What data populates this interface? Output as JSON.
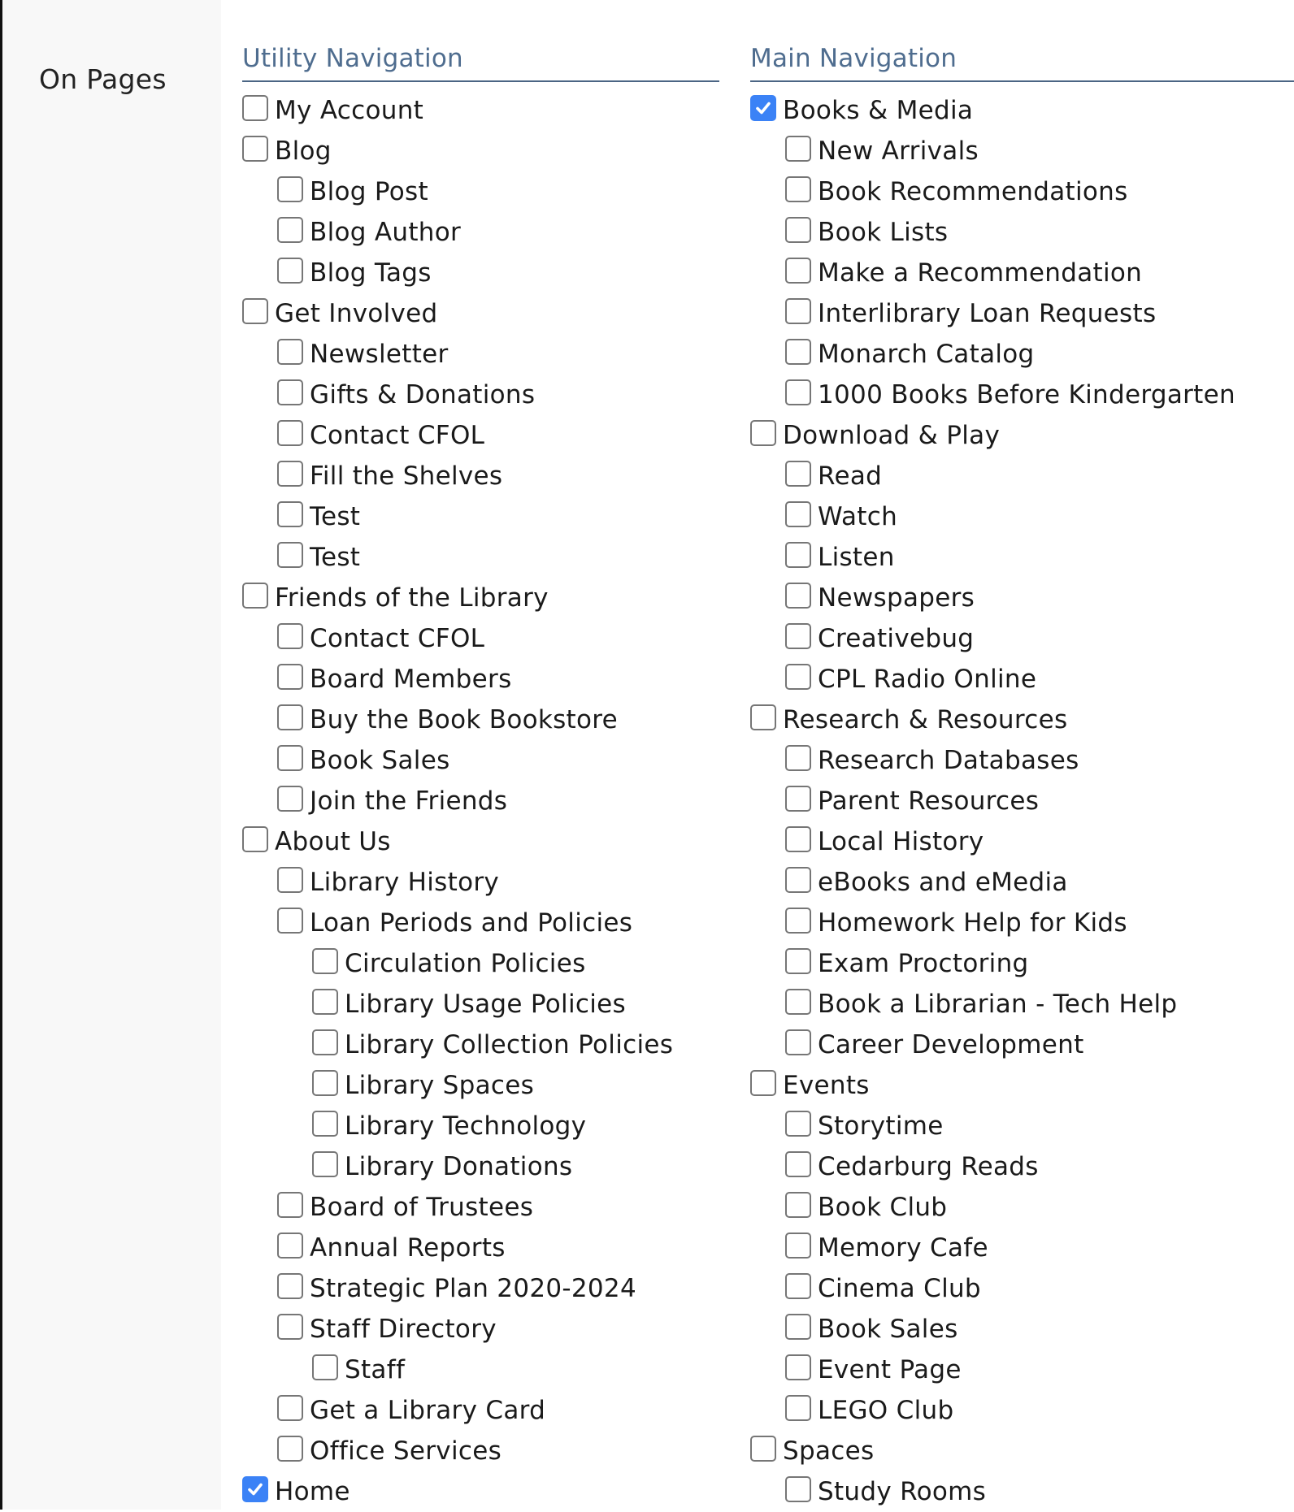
{
  "field_label": "On Pages",
  "colors": {
    "accent": "#3b82f6",
    "header_text": "#4f6d8f",
    "header_rule": "#4b6584",
    "label_panel": "#f8f8f8"
  },
  "utility_navigation": {
    "title": "Utility Navigation",
    "items": [
      {
        "label": "My Account",
        "level": 0,
        "checked": false
      },
      {
        "label": "Blog",
        "level": 0,
        "checked": false
      },
      {
        "label": "Blog Post",
        "level": 1,
        "checked": false
      },
      {
        "label": "Blog Author",
        "level": 1,
        "checked": false
      },
      {
        "label": "Blog Tags",
        "level": 1,
        "checked": false
      },
      {
        "label": "Get Involved",
        "level": 0,
        "checked": false
      },
      {
        "label": "Newsletter",
        "level": 1,
        "checked": false
      },
      {
        "label": "Gifts & Donations",
        "level": 1,
        "checked": false
      },
      {
        "label": "Contact CFOL",
        "level": 1,
        "checked": false
      },
      {
        "label": "Fill the Shelves",
        "level": 1,
        "checked": false
      },
      {
        "label": "Test",
        "level": 1,
        "checked": false
      },
      {
        "label": "Test",
        "level": 1,
        "checked": false
      },
      {
        "label": "Friends of the Library",
        "level": 0,
        "checked": false
      },
      {
        "label": "Contact CFOL",
        "level": 1,
        "checked": false
      },
      {
        "label": "Board Members",
        "level": 1,
        "checked": false
      },
      {
        "label": "Buy the Book Bookstore",
        "level": 1,
        "checked": false
      },
      {
        "label": "Book Sales",
        "level": 1,
        "checked": false
      },
      {
        "label": "Join the Friends",
        "level": 1,
        "checked": false
      },
      {
        "label": "About Us",
        "level": 0,
        "checked": false
      },
      {
        "label": "Library History",
        "level": 1,
        "checked": false
      },
      {
        "label": "Loan Periods and Policies",
        "level": 1,
        "checked": false
      },
      {
        "label": "Circulation Policies",
        "level": 2,
        "checked": false
      },
      {
        "label": "Library Usage Policies",
        "level": 2,
        "checked": false
      },
      {
        "label": "Library Collection Policies",
        "level": 2,
        "checked": false
      },
      {
        "label": "Library Spaces",
        "level": 2,
        "checked": false
      },
      {
        "label": "Library Technology",
        "level": 2,
        "checked": false
      },
      {
        "label": "Library Donations",
        "level": 2,
        "checked": false
      },
      {
        "label": "Board of Trustees",
        "level": 1,
        "checked": false
      },
      {
        "label": "Annual Reports",
        "level": 1,
        "checked": false
      },
      {
        "label": "Strategic Plan 2020-2024",
        "level": 1,
        "checked": false
      },
      {
        "label": "Staff Directory",
        "level": 1,
        "checked": false
      },
      {
        "label": "Staff",
        "level": 2,
        "checked": false
      },
      {
        "label": "Get a Library Card",
        "level": 1,
        "checked": false
      },
      {
        "label": "Office Services",
        "level": 1,
        "checked": false
      },
      {
        "label": "Home",
        "level": 0,
        "checked": true
      }
    ]
  },
  "main_navigation": {
    "title": "Main Navigation",
    "items": [
      {
        "label": "Books & Media",
        "level": 0,
        "checked": true
      },
      {
        "label": "New Arrivals",
        "level": 1,
        "checked": false
      },
      {
        "label": "Book Recommendations",
        "level": 1,
        "checked": false
      },
      {
        "label": "Book Lists",
        "level": 1,
        "checked": false
      },
      {
        "label": "Make a Recommendation",
        "level": 1,
        "checked": false
      },
      {
        "label": "Interlibrary Loan Requests",
        "level": 1,
        "checked": false
      },
      {
        "label": "Monarch Catalog",
        "level": 1,
        "checked": false
      },
      {
        "label": "1000 Books Before Kindergarten",
        "level": 1,
        "checked": false
      },
      {
        "label": "Download & Play",
        "level": 0,
        "checked": false
      },
      {
        "label": "Read",
        "level": 1,
        "checked": false
      },
      {
        "label": "Watch",
        "level": 1,
        "checked": false
      },
      {
        "label": "Listen",
        "level": 1,
        "checked": false
      },
      {
        "label": "Newspapers",
        "level": 1,
        "checked": false
      },
      {
        "label": "Creativebug",
        "level": 1,
        "checked": false
      },
      {
        "label": "CPL Radio Online",
        "level": 1,
        "checked": false
      },
      {
        "label": "Research & Resources",
        "level": 0,
        "checked": false
      },
      {
        "label": "Research Databases",
        "level": 1,
        "checked": false
      },
      {
        "label": "Parent Resources",
        "level": 1,
        "checked": false
      },
      {
        "label": "Local History",
        "level": 1,
        "checked": false
      },
      {
        "label": "eBooks and eMedia",
        "level": 1,
        "checked": false
      },
      {
        "label": "Homework Help for Kids",
        "level": 1,
        "checked": false
      },
      {
        "label": "Exam Proctoring",
        "level": 1,
        "checked": false
      },
      {
        "label": "Book a Librarian - Tech Help",
        "level": 1,
        "checked": false
      },
      {
        "label": "Career Development",
        "level": 1,
        "checked": false
      },
      {
        "label": "Events",
        "level": 0,
        "checked": false
      },
      {
        "label": "Storytime",
        "level": 1,
        "checked": false
      },
      {
        "label": "Cedarburg Reads",
        "level": 1,
        "checked": false
      },
      {
        "label": "Book Club",
        "level": 1,
        "checked": false
      },
      {
        "label": "Memory Cafe",
        "level": 1,
        "checked": false
      },
      {
        "label": "Cinema Club",
        "level": 1,
        "checked": false
      },
      {
        "label": "Book Sales",
        "level": 1,
        "checked": false
      },
      {
        "label": "Event Page",
        "level": 1,
        "checked": false
      },
      {
        "label": "LEGO Club",
        "level": 1,
        "checked": false
      },
      {
        "label": "Spaces",
        "level": 0,
        "checked": false
      },
      {
        "label": "Study Rooms",
        "level": 1,
        "checked": false
      }
    ]
  }
}
